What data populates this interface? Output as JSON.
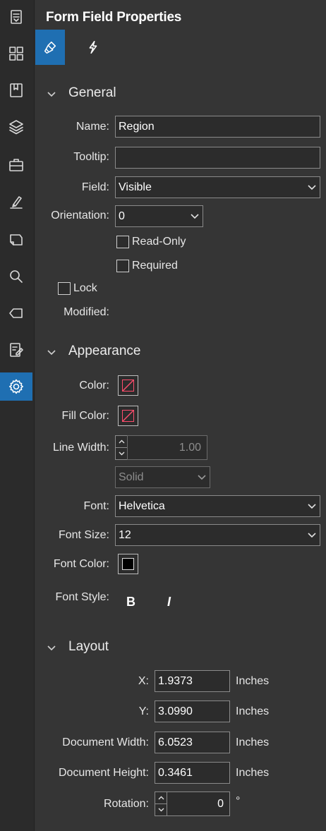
{
  "panel": {
    "title": "Form Field Properties"
  },
  "toolbar": {
    "icons": [
      "document-list-icon",
      "thumbnails-icon",
      "bookmark-icon",
      "layers-icon",
      "toolbox-icon",
      "sign-pen-icon",
      "tag-shape-icon",
      "search-icon",
      "label-icon",
      "edit-form-icon",
      "settings-icon"
    ],
    "active": "settings-icon"
  },
  "tabs": {
    "active": "brush-icon"
  },
  "general": {
    "header": "General",
    "name_label": "Name:",
    "name_value": "Region",
    "tooltip_label": "Tooltip:",
    "tooltip_value": "",
    "field_label": "Field:",
    "field_value": "Visible",
    "orientation_label": "Orientation:",
    "orientation_value": "0",
    "readonly_label": "Read-Only",
    "required_label": "Required",
    "lock_label": "Lock",
    "modified_label": "Modified:"
  },
  "appearance": {
    "header": "Appearance",
    "color_label": "Color:",
    "fill_color_label": "Fill Color:",
    "line_width_label": "Line Width:",
    "line_width_value": "1.00",
    "line_style_value": "Solid",
    "font_label": "Font:",
    "font_value": "Helvetica",
    "font_size_label": "Font Size:",
    "font_size_value": "12",
    "font_color_label": "Font Color:",
    "font_color": "#000000",
    "font_style_label": "Font Style:",
    "bold_label": "B",
    "italic_label": "I"
  },
  "layout": {
    "header": "Layout",
    "x_label": "X:",
    "x_value": "1.9373",
    "y_label": "Y:",
    "y_value": "3.0990",
    "width_label": "Document Width:",
    "width_value": "6.0523",
    "height_label": "Document Height:",
    "height_value": "0.3461",
    "unit": "Inches",
    "rotation_label": "Rotation:",
    "rotation_value": "0",
    "rotation_unit": "°"
  },
  "colors": {
    "accent": "#1f6fb2",
    "panel_bg": "#353535"
  }
}
